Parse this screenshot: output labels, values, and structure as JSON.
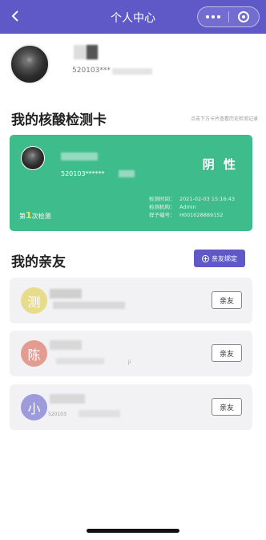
{
  "nav": {
    "title": "个人中心"
  },
  "profile": {
    "id_masked": "520103***"
  },
  "card_section": {
    "title": "我的核酸检测卡",
    "hint": "点击下方卡片查看历史检测记录"
  },
  "card": {
    "id_masked": "520103******",
    "result": "阴 性",
    "info_labels": [
      "检测时间：",
      "检测机构：",
      "样子编号："
    ],
    "info_values": [
      "2021-02-03 15:16:43",
      "Admin",
      "H001028889152"
    ],
    "count_prefix": "第",
    "count": "1",
    "count_suffix": "次检测"
  },
  "friends_section": {
    "title": "我的亲友",
    "bind_label": "亲友绑定"
  },
  "friends": [
    {
      "initial": "测",
      "color": "#e6dc8a",
      "button": "亲友",
      "sub": ""
    },
    {
      "initial": "陈",
      "color": "#e39c92",
      "button": "亲友",
      "sub": "ji"
    },
    {
      "initial": "小",
      "color": "#9d9bdc",
      "button": "亲友",
      "sub": "520103"
    }
  ]
}
